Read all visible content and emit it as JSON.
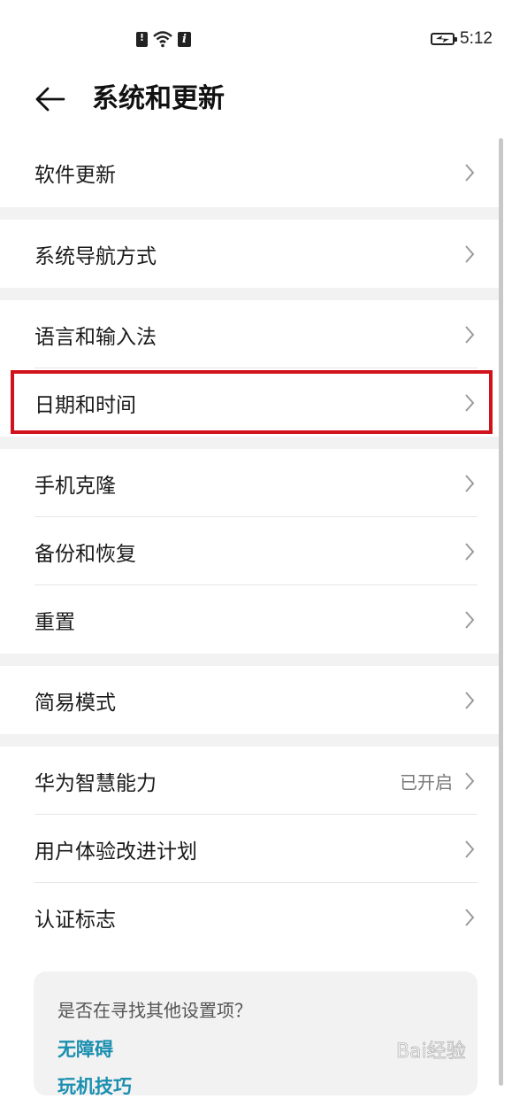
{
  "status_bar": {
    "time": "5:12",
    "icons": [
      "sim-alert-icon",
      "wifi-icon",
      "info-icon",
      "battery-charging-icon"
    ]
  },
  "header": {
    "title": "系统和更新",
    "back_icon": "back-arrow-icon"
  },
  "groups": [
    {
      "items": [
        {
          "label": "软件更新"
        }
      ]
    },
    {
      "items": [
        {
          "label": "系统导航方式"
        }
      ]
    },
    {
      "items": [
        {
          "label": "语言和输入法"
        },
        {
          "label": "日期和时间",
          "highlighted": true
        }
      ]
    },
    {
      "items": [
        {
          "label": "手机克隆"
        },
        {
          "label": "备份和恢复"
        },
        {
          "label": "重置"
        }
      ]
    },
    {
      "items": [
        {
          "label": "简易模式"
        }
      ]
    },
    {
      "items": [
        {
          "label": "华为智慧能力",
          "value": "已开启"
        },
        {
          "label": "用户体验改进计划"
        },
        {
          "label": "认证标志"
        }
      ]
    }
  ],
  "suggestion_card": {
    "question": "是否在寻找其他设置项？",
    "link1": "无障碍",
    "link2": "玩机技巧"
  },
  "colors": {
    "highlight_border": "#d0121b",
    "link": "#1a8fb0",
    "group_gap": "#f2f2f2"
  },
  "watermark_text": "Bai经验"
}
